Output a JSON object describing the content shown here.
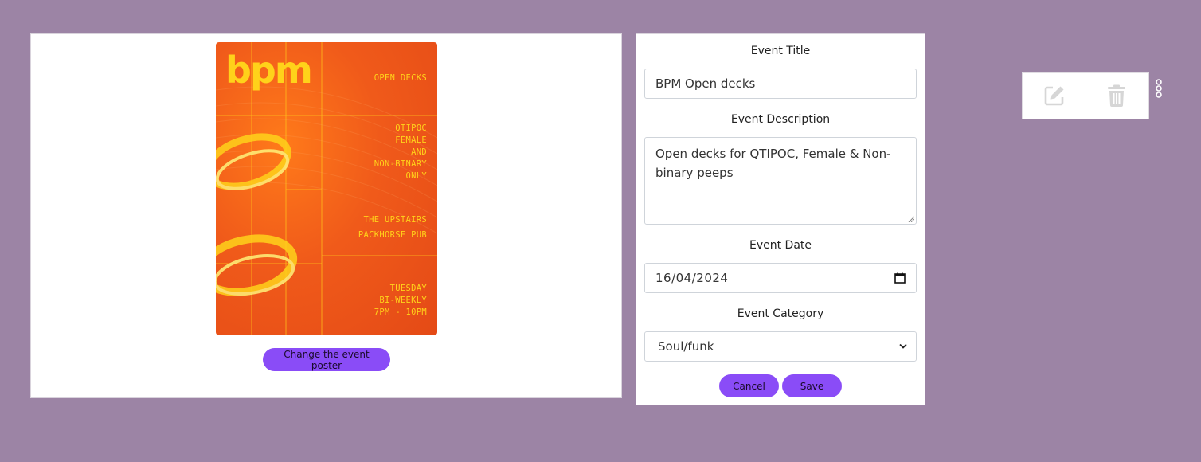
{
  "poster": {
    "logo": "bpm",
    "lines_1": "OPEN DECKS",
    "lines_2": "QTIPOC\nFEMALE\nAND\nNON-BINARY\nONLY",
    "lines_3": "THE UPSTAIRS\nPACKHORSE PUB",
    "lines_4": "TUESDAY\nBI-WEEKLY\n7PM - 10PM"
  },
  "change_poster_label": "Change the event poster",
  "form": {
    "title_label": "Event Title",
    "title_value": "BPM Open decks",
    "description_label": "Event Description",
    "description_value": "Open decks for QTIPOC, Female & Non-binary peeps",
    "date_label": "Event Date",
    "date_value": "16/04/2024",
    "category_label": "Event Category",
    "category_value": "Soul/funk",
    "cancel_label": "Cancel",
    "save_label": "Save"
  },
  "icons": {
    "calendar": "calendar-icon",
    "chevron": "chevron-down-icon",
    "edit": "edit-icon",
    "delete": "trash-icon",
    "more": "kebab-menu-icon"
  },
  "colors": {
    "background": "#9c84a5",
    "button": "#8a4cf7",
    "poster_orange": "#e44a16",
    "poster_yellow": "#ffd21a"
  }
}
